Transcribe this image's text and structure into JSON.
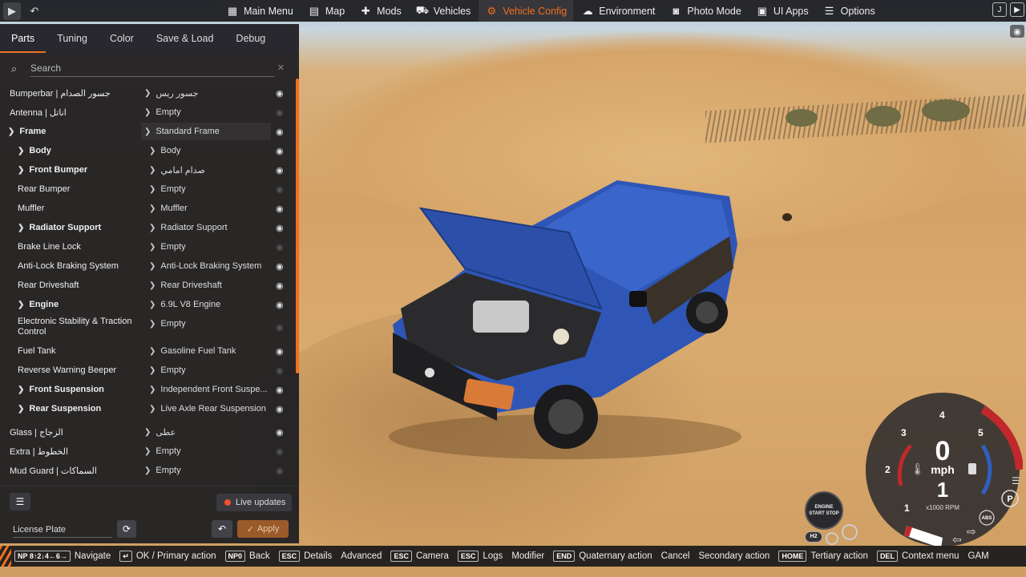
{
  "topbar": {
    "menu": [
      {
        "label": "Main Menu",
        "icon": "dashboard-icon"
      },
      {
        "label": "Map",
        "icon": "map-icon"
      },
      {
        "label": "Mods",
        "icon": "puzzle-icon"
      },
      {
        "label": "Vehicles",
        "icon": "car-icon"
      },
      {
        "label": "Vehicle Config",
        "icon": "engine-icon",
        "active": true
      },
      {
        "label": "Environment",
        "icon": "weather-icon"
      },
      {
        "label": "Photo Mode",
        "icon": "camera-icon"
      },
      {
        "label": "UI Apps",
        "icon": "apps-icon"
      },
      {
        "label": "Options",
        "icon": "sliders-icon"
      }
    ],
    "right_key": "J"
  },
  "panel": {
    "tabs": [
      "Parts",
      "Tuning",
      "Color",
      "Save & Load",
      "Debug"
    ],
    "active_tab": "Parts",
    "search_placeholder": "Search",
    "rows": [
      {
        "name": "Bumperbar | جسور الصدام",
        "value": "جسور ريس",
        "indent": 0,
        "expand": false,
        "bold": false,
        "visible": true
      },
      {
        "name": "Antenna | اناتل",
        "value": "Empty",
        "indent": 0,
        "expand": false,
        "bold": false,
        "visible": false
      },
      {
        "name": "Frame",
        "value": "Standard Frame",
        "indent": 0,
        "expand": true,
        "bold": true,
        "visible": true
      },
      {
        "name": "Body",
        "value": "Body",
        "indent": 1,
        "expand": true,
        "bold": true,
        "visible": true
      },
      {
        "name": "Front Bumper",
        "value": "صدام امامي",
        "indent": 1,
        "expand": true,
        "bold": true,
        "visible": true
      },
      {
        "name": "Rear Bumper",
        "value": "Empty",
        "indent": 1,
        "expand": false,
        "bold": false,
        "visible": false
      },
      {
        "name": "Muffler",
        "value": "Muffler",
        "indent": 1,
        "expand": false,
        "bold": false,
        "visible": true
      },
      {
        "name": "Radiator Support",
        "value": "Radiator Support",
        "indent": 1,
        "expand": true,
        "bold": true,
        "visible": true
      },
      {
        "name": "Brake Line Lock",
        "value": "Empty",
        "indent": 1,
        "expand": false,
        "bold": false,
        "visible": false
      },
      {
        "name": "Anti-Lock Braking System",
        "value": "Anti-Lock Braking System",
        "indent": 1,
        "expand": false,
        "bold": false,
        "visible": true
      },
      {
        "name": "Rear Driveshaft",
        "value": "Rear Driveshaft",
        "indent": 1,
        "expand": false,
        "bold": false,
        "visible": true
      },
      {
        "name": "Engine",
        "value": "6.9L V8 Engine",
        "indent": 1,
        "expand": true,
        "bold": true,
        "visible": true
      },
      {
        "name": "Electronic Stability & Traction Control",
        "value": "Empty",
        "indent": 1,
        "expand": false,
        "bold": false,
        "visible": false
      },
      {
        "name": "Fuel Tank",
        "value": "Gasoline Fuel Tank",
        "indent": 1,
        "expand": false,
        "bold": false,
        "visible": true
      },
      {
        "name": "Reverse Warning Beeper",
        "value": "Empty",
        "indent": 1,
        "expand": false,
        "bold": false,
        "visible": false
      },
      {
        "name": "Front Suspension",
        "value": "Independent Front Suspe...",
        "indent": 1,
        "expand": true,
        "bold": true,
        "visible": true
      },
      {
        "name": "Rear Suspension",
        "value": "Live Axle Rear Suspension",
        "indent": 1,
        "expand": true,
        "bold": true,
        "visible": true
      },
      {
        "name": "Glass | الزجاج",
        "value": "عطى",
        "indent": 0,
        "expand": false,
        "bold": false,
        "visible": true
      },
      {
        "name": "Extra | الخطوط",
        "value": "Empty",
        "indent": 0,
        "expand": false,
        "bold": false,
        "visible": false
      },
      {
        "name": "Mud Guard | السماكات",
        "value": "Empty",
        "indent": 0,
        "expand": false,
        "bold": false,
        "visible": false
      }
    ],
    "live_updates": "Live updates",
    "license_plate": "License Plate",
    "apply": "Apply"
  },
  "actionbar": [
    {
      "key": "NP 8↑2↓4←6→",
      "label": "Navigate"
    },
    {
      "key": "↵",
      "label": "OK / Primary action"
    },
    {
      "key": "NP0",
      "label": "Back"
    },
    {
      "key": "ESC",
      "label": "Details"
    },
    {
      "key": "",
      "label": "Advanced"
    },
    {
      "key": "ESC",
      "label": "Camera"
    },
    {
      "key": "ESC",
      "label": "Logs"
    },
    {
      "key": "",
      "label": "Modifier"
    },
    {
      "key": "END",
      "label": "Quaternary action"
    },
    {
      "key": "",
      "label": "Cancel"
    },
    {
      "key": "",
      "label": "Secondary action"
    },
    {
      "key": "HOME",
      "label": "Tertiary action"
    },
    {
      "key": "DEL",
      "label": "Context menu"
    },
    {
      "key": "",
      "label": "GAM"
    }
  ],
  "gauge": {
    "speed": "0",
    "unit": "mph",
    "gear": "1",
    "rpm_label": "x1000 RPM",
    "ticks": [
      "1",
      "2",
      "3",
      "4",
      "5"
    ],
    "engine_button": "ENGINE START STOP",
    "park": "P",
    "abs": "ABS",
    "h2": "H2",
    "colors": {
      "redline": "#c0282c",
      "accent": "#f07020"
    }
  }
}
